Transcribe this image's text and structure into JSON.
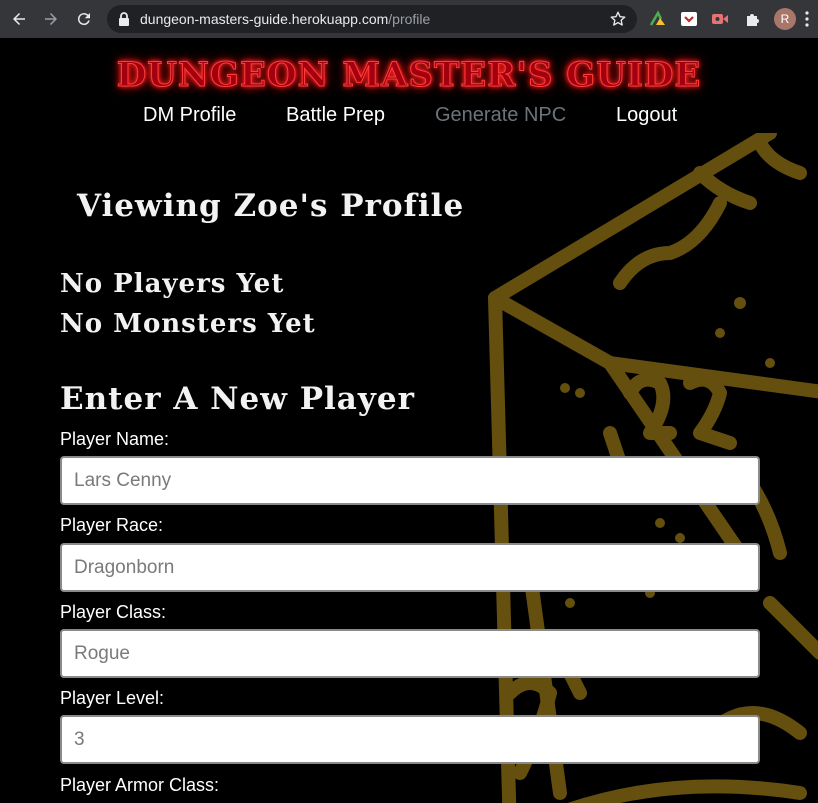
{
  "browser": {
    "url_host": "dungeon-masters-guide.herokuapp.com",
    "url_path": "/profile",
    "profile_initial": "R"
  },
  "site": {
    "title": "DUNGEON MASTER'S GUIDE",
    "title_color": "#a3000f",
    "accent_gold": "#6b5410"
  },
  "nav": {
    "items": [
      {
        "label": "DM Profile"
      },
      {
        "label": "Battle Prep"
      },
      {
        "label": "Generate NPC"
      },
      {
        "label": "Logout"
      }
    ]
  },
  "profile": {
    "heading": "Viewing Zoe's Profile",
    "players_status": "No Players Yet",
    "monsters_status": "No Monsters Yet"
  },
  "form": {
    "heading": "Enter A New Player",
    "fields": [
      {
        "label": "Player Name:",
        "placeholder": "Lars Cenny"
      },
      {
        "label": "Player Race:",
        "placeholder": "Dragonborn"
      },
      {
        "label": "Player Class:",
        "placeholder": "Rogue"
      },
      {
        "label": "Player Level:",
        "placeholder": "3"
      },
      {
        "label": "Player Armor Class:",
        "placeholder": ""
      }
    ]
  }
}
